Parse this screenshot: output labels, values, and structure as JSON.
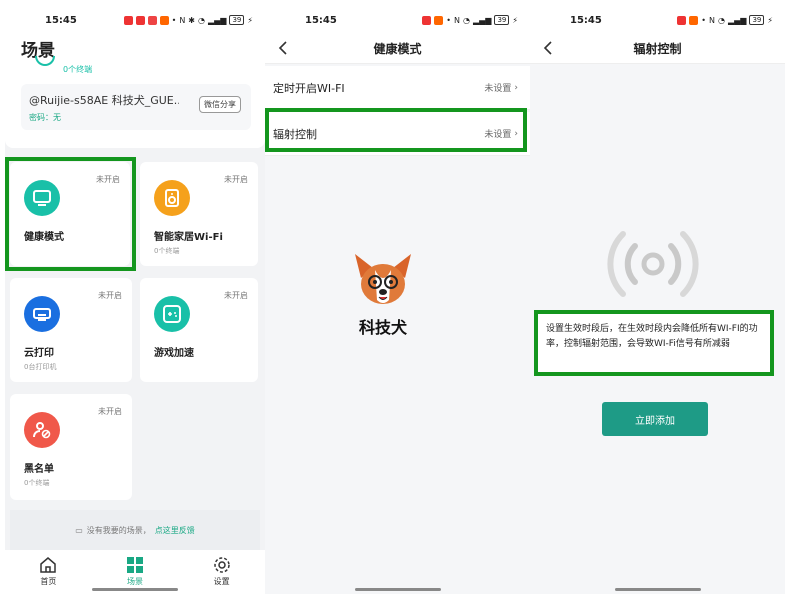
{
  "status_bar": {
    "time": "15:45",
    "battery": "39"
  },
  "scene": {
    "title": "场景",
    "wifi_card": {
      "ssid": "@Ruijie-s58AE 科技犬_GUE...",
      "password_label": "密码：无",
      "share_button": "微信分享",
      "partial_caption": "0个终端"
    },
    "tiles": [
      {
        "name": "健康模式",
        "status": "未开启",
        "sub": "",
        "color": "#19c0a8"
      },
      {
        "name": "智能家居Wi-Fi",
        "status": "未开启",
        "sub": "0个终端",
        "color": "#f5a11c"
      },
      {
        "name": "云打印",
        "status": "未开启",
        "sub": "0台打印机",
        "color": "#1a6fe0"
      },
      {
        "name": "游戏加速",
        "status": "未开启",
        "sub": "",
        "color": "#19c0a8"
      },
      {
        "name": "黑名单",
        "status": "未开启",
        "sub": "0个终端",
        "color": "#f0584a"
      }
    ],
    "feedback": {
      "text": "没有我要的场景，",
      "link": "点这里反馈"
    },
    "tabs": {
      "home": "首页",
      "scene": "场景",
      "settings": "设置"
    }
  },
  "health_mode": {
    "title": "健康模式",
    "rows": [
      {
        "label": "定时开启WI-FI",
        "value": "未设置"
      },
      {
        "label": "辐射控制",
        "value": "未设置"
      }
    ],
    "watermark": "科技犬"
  },
  "radiation": {
    "title": "辐射控制",
    "description": "设置生效时段后，在生效时段内会降低所有WI-FI的功率，控制辐射范围，会导致WI-Fi信号有所减弱",
    "add_button": "立即添加"
  },
  "colors": {
    "accent": "#19a884",
    "highlight": "#14961e",
    "button": "#1e9b86"
  }
}
